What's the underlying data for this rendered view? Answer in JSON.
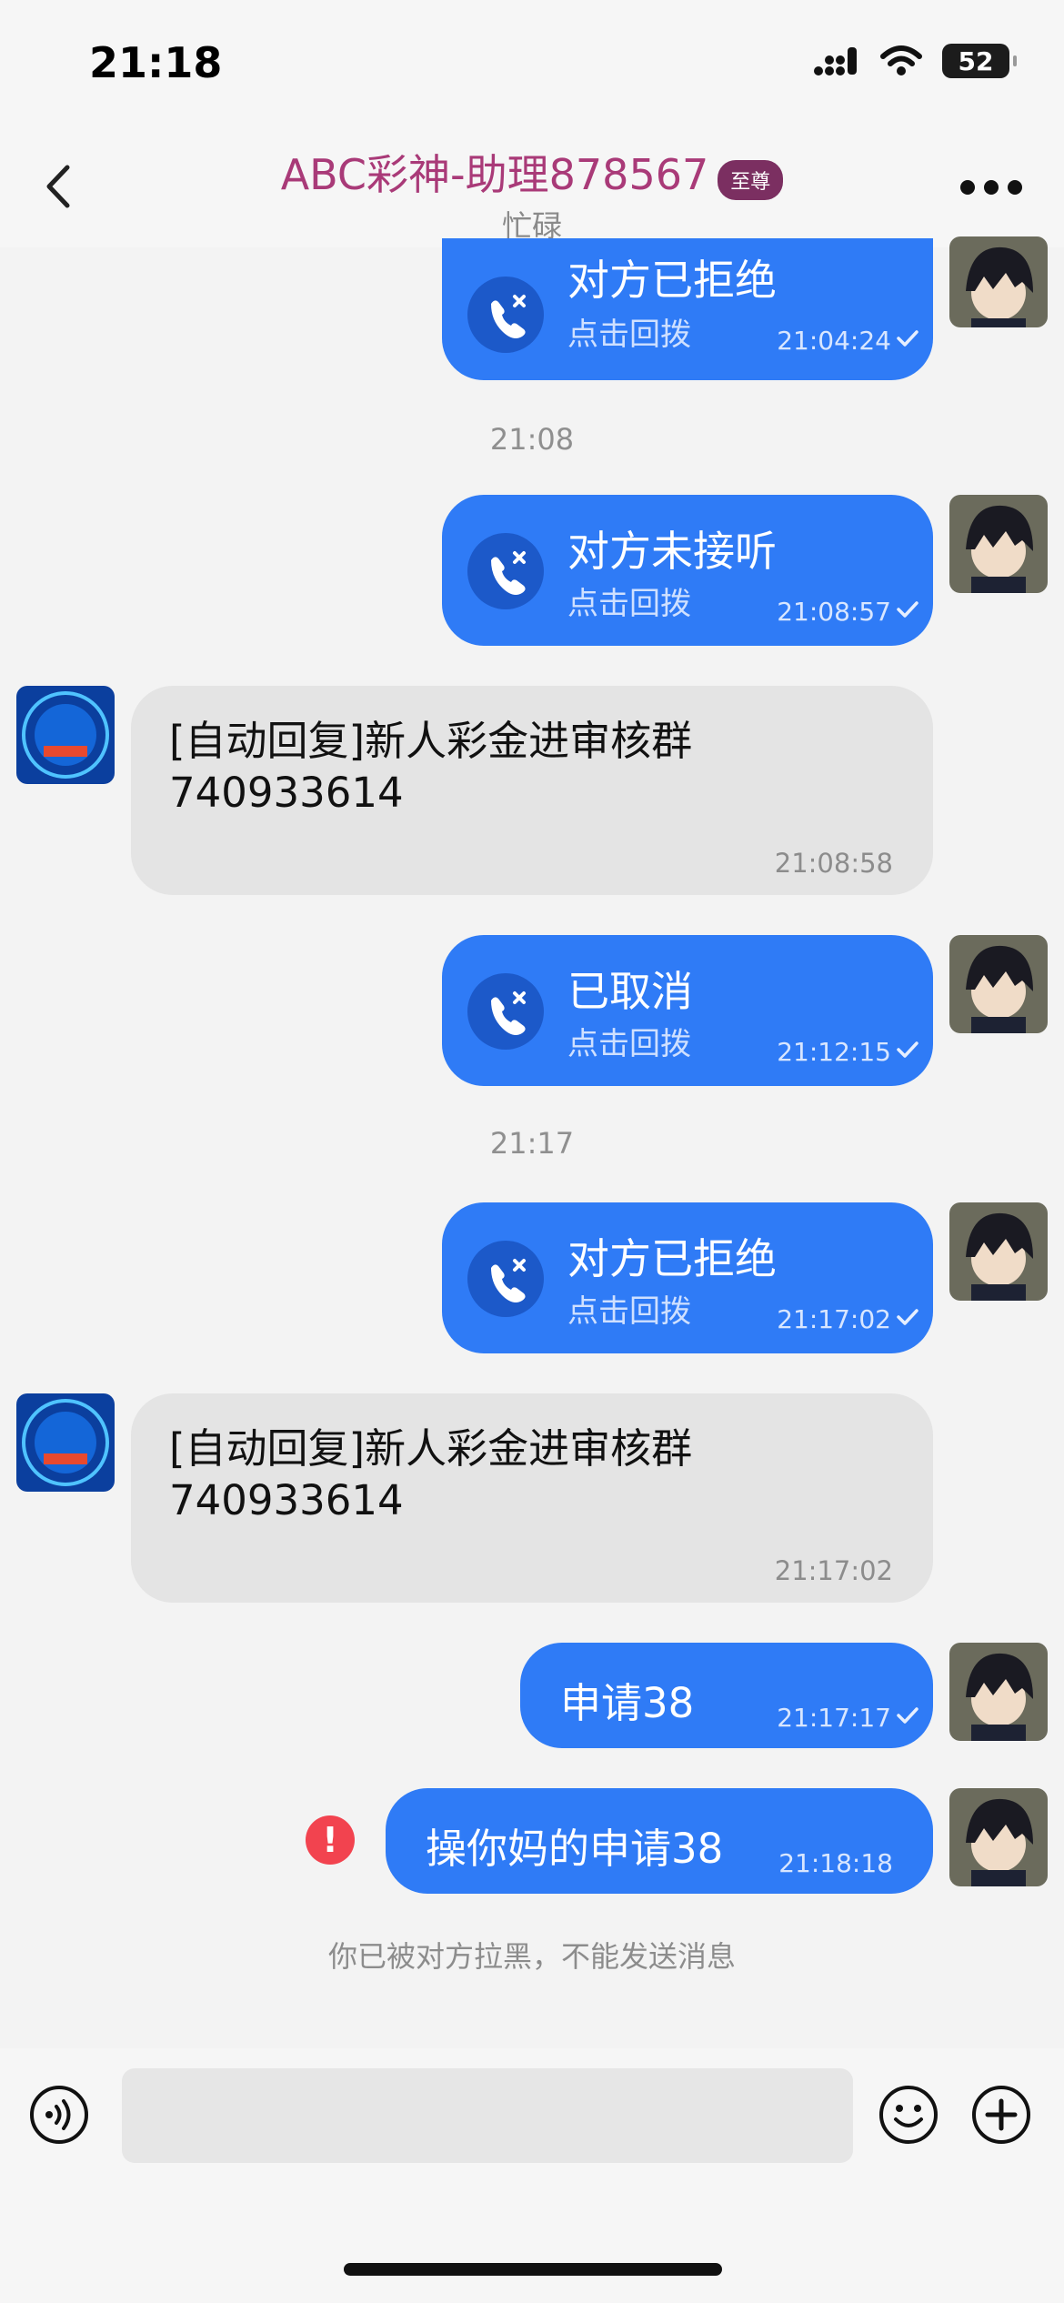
{
  "status_bar": {
    "time": "21:18",
    "battery": "52"
  },
  "header": {
    "title": "ABC彩神-助理878567",
    "badge": "至尊",
    "subtitle": "忙碌"
  },
  "messages": {
    "m1": {
      "title": "对方已拒绝",
      "sub": "点击回拨",
      "time": "21:04:24"
    },
    "d1": "21:08",
    "m2": {
      "title": "对方未接听",
      "sub": "点击回拨",
      "time": "21:08:57"
    },
    "m3": {
      "text": "[自动回复]新人彩金进审核群740933614",
      "time": "21:08:58"
    },
    "m4": {
      "title": "已取消",
      "sub": "点击回拨",
      "time": "21:12:15"
    },
    "d2": "21:17",
    "m5": {
      "title": "对方已拒绝",
      "sub": "点击回拨",
      "time": "21:17:02"
    },
    "m6": {
      "text": "[自动回复]新人彩金进审核群740933614",
      "time": "21:17:02"
    },
    "m7": {
      "text": "申请38",
      "time": "21:17:17"
    },
    "m8": {
      "text": "操你妈的申请38",
      "time": "21:18:18",
      "error_mark": "!"
    }
  },
  "blocked_notice": "你已被对方拉黑，不能发送消息",
  "input": {
    "placeholder": ""
  },
  "colors": {
    "accent": "#2f7bf6",
    "title": "#a93a78",
    "error": "#f2434f"
  }
}
